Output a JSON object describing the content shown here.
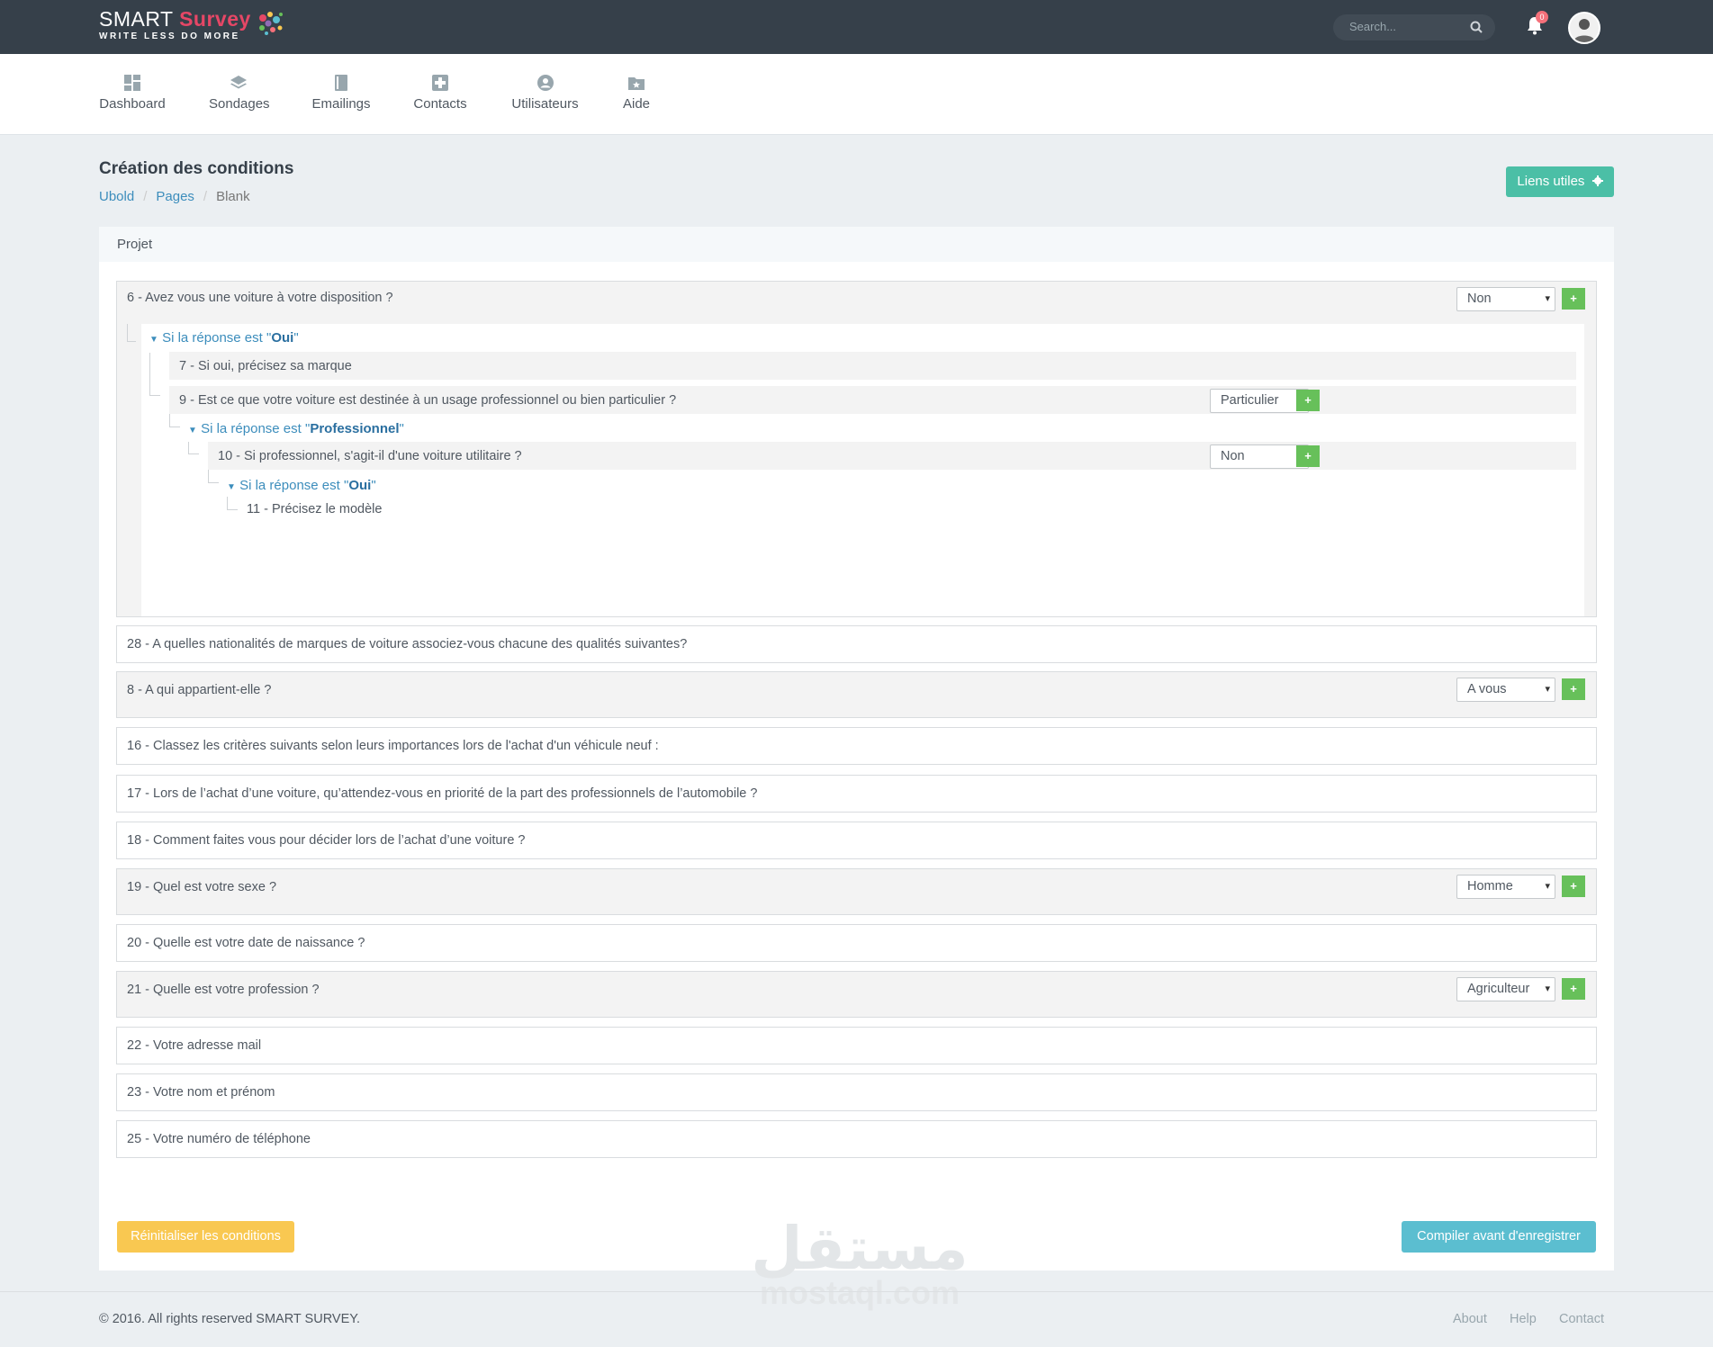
{
  "brand": {
    "name_part1": "SMART",
    "name_part2": "Survey",
    "tagline": "WRITE LESS DO MORE"
  },
  "topbar": {
    "search_placeholder": "Search...",
    "notification_count": "0"
  },
  "nav": [
    {
      "label": "Dashboard",
      "icon": "dashboard-icon"
    },
    {
      "label": "Sondages",
      "icon": "layers-icon"
    },
    {
      "label": "Emailings",
      "icon": "book-icon"
    },
    {
      "label": "Contacts",
      "icon": "contacts-icon"
    },
    {
      "label": "Utilisateurs",
      "icon": "user-icon"
    },
    {
      "label": "Aide",
      "icon": "folder-star-icon"
    }
  ],
  "page": {
    "title": "Création des conditions",
    "breadcrumb": [
      "Ubold",
      "Pages",
      "Blank"
    ],
    "liens_utiles": "Liens utiles"
  },
  "card": {
    "header": "Projet",
    "q6": {
      "text": "6 - Avez vous une voiture à votre disposition ?",
      "select": "Non"
    },
    "cond_oui_1": {
      "prefix": "Si la réponse est \"",
      "value": "Oui",
      "suffix": "\""
    },
    "q7": {
      "text": "7 - Si oui, précisez sa marque"
    },
    "q9": {
      "text": "9 - Est ce que votre voiture est destinée à un usage professionnel ou bien particulier ?",
      "select": "Particulier"
    },
    "cond_pro": {
      "prefix": "Si la réponse est \"",
      "value": "Professionnel",
      "suffix": "\""
    },
    "q10": {
      "text": "10 - Si professionnel, s'agit-il d'une voiture utilitaire ?",
      "select": "Non"
    },
    "cond_oui_2": {
      "prefix": "Si la réponse est \"",
      "value": "Oui",
      "suffix": "\""
    },
    "q11": {
      "text": "11 - Précisez le modèle"
    },
    "q28": {
      "text": "28 - A quelles nationalités de marques de voiture associez-vous chacune des qualités suivantes?"
    },
    "q8": {
      "text": "8 - A qui appartient-elle ?",
      "select": "A vous"
    },
    "q16": {
      "text": "16 - Classez les critères suivants selon leurs importances lors de l'achat d'un véhicule neuf :"
    },
    "q17": {
      "text": "17 - Lors de l’achat d’une voiture, qu’attendez-vous en priorité de la part des professionnels de l’automobile ?"
    },
    "q18": {
      "text": "18 - Comment faites vous pour décider lors de l’achat d’une voiture ?"
    },
    "q19": {
      "text": "19 - Quel est votre sexe ?",
      "select": "Homme"
    },
    "q20": {
      "text": "20 - Quelle est votre date de naissance ?"
    },
    "q21": {
      "text": "21 - Quelle est votre profession ?",
      "select": "Agriculteur"
    },
    "q22": {
      "text": "22 - Votre adresse mail"
    },
    "q23": {
      "text": "23 - Votre nom et prénom"
    },
    "q25": {
      "text": "25 - Votre numéro de téléphone"
    },
    "plus_label": "+",
    "reset_label": "Réinitialiser les conditions",
    "compile_label": "Compiler avant d'enregistrer"
  },
  "watermark": {
    "arabic": "مستقل",
    "latin": "mostaql.com"
  },
  "footer": {
    "copyright": "© 2016. All rights reserved SMART SURVEY.",
    "links": [
      "About",
      "Help",
      "Contact"
    ]
  },
  "colors": {
    "topbar": "#36404a",
    "accent_teal": "#4bbfa6",
    "plus_green": "#67c05a",
    "reset_yellow": "#f9c851",
    "compile_blue": "#5bbed0",
    "link_blue": "#3c8dbc",
    "logo_red": "#e64766"
  }
}
